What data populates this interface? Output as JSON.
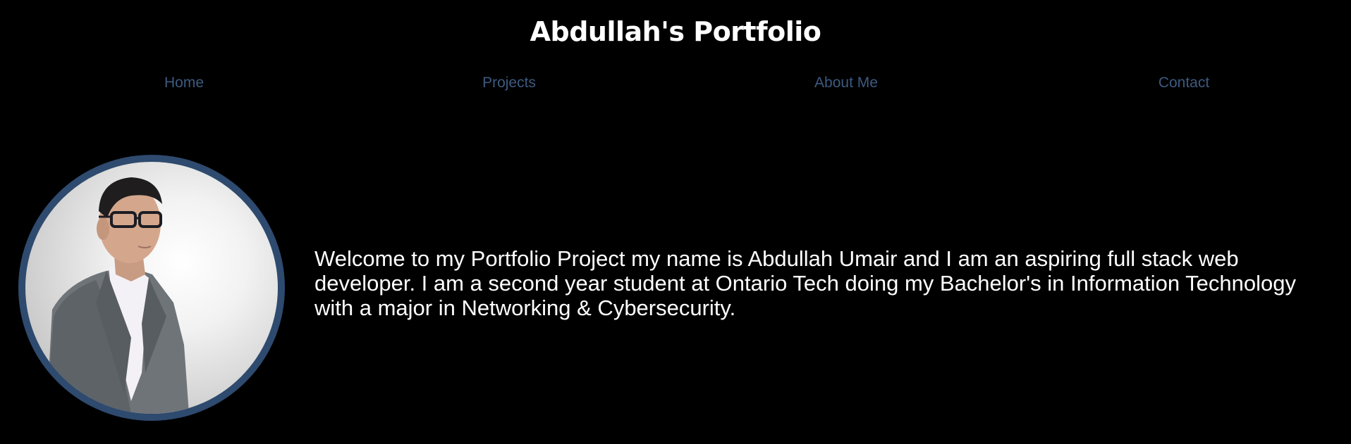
{
  "header": {
    "title": "Abdullah's Portfolio"
  },
  "nav": {
    "items": [
      {
        "label": "Home"
      },
      {
        "label": "Projects"
      },
      {
        "label": "About Me"
      },
      {
        "label": "Contact"
      }
    ]
  },
  "hero": {
    "intro": "Welcome to my Portfolio Project my name is Abdullah Umair and I am an aspiring full stack web developer. I am a second year student at Ontario Tech doing my Bachelor's in Information Technology with a major in Networking & Cybersecurity."
  },
  "colors": {
    "background": "#000000",
    "title": "#ffffff",
    "nav_link": "#3d5a80",
    "avatar_border": "#2e4a6e",
    "text": "#ffffff"
  }
}
